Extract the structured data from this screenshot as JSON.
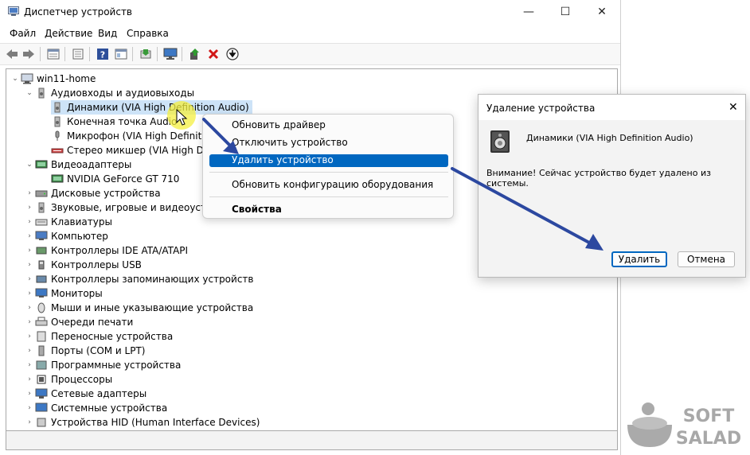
{
  "window": {
    "title": "Диспетчер устройств",
    "controls": {
      "minimize": "—",
      "maximize": "☐",
      "close": "✕"
    }
  },
  "menu": [
    "Файл",
    "Действие",
    "Вид",
    "Справка"
  ],
  "toolbar_icons": [
    "back-icon",
    "forward-icon",
    "properties-icon",
    "device-list-icon",
    "help-icon",
    "details-icon",
    "update-driver-icon",
    "monitor-icon",
    "add-device-icon",
    "remove-icon",
    "download-icon"
  ],
  "tree": {
    "root": "win11-home",
    "audio_group": "Аудиовходы и аудиовыходы",
    "audio_children": [
      "Динамики (VIA High Definition Audio)",
      "Конечная точка Audio",
      "Микрофон (VIA High Definiti",
      "Стерео микшер (VIA High Defi"
    ],
    "video_group": "Видеоадаптеры",
    "video_children": [
      "NVIDIA GeForce GT 710"
    ],
    "groups": [
      "Дисковые устройства",
      "Звуковые, игровые и видеоустро",
      "Клавиатуры",
      "Компьютер",
      "Контроллеры IDE ATA/ATAPI",
      "Контроллеры USB",
      "Контроллеры запоминающих устройств",
      "Мониторы",
      "Мыши и иные указывающие устройства",
      "Очереди печати",
      "Переносные устройства",
      "Порты (COM и LPT)",
      "Программные устройства",
      "Процессоры",
      "Сетевые адаптеры",
      "Системные устройства",
      "Устройства HID (Human Interface Devices)"
    ]
  },
  "context_menu": {
    "update_driver": "Обновить драйвер",
    "disable": "Отключить устройство",
    "uninstall": "Удалить устройство",
    "scan": "Обновить конфигурацию оборудования",
    "properties": "Свойства"
  },
  "dialog": {
    "title": "Удаление устройства",
    "device_name": "Динамики (VIA High Definition Audio)",
    "warning": "Внимание! Сейчас устройство будет удалено из системы.",
    "ok_label": "Удалить",
    "cancel_label": "Отмена",
    "close": "✕"
  },
  "watermark": {
    "line1": "SOFT",
    "line2": "SALAD"
  },
  "colors": {
    "accent": "#0067c0",
    "arrow": "#2c48a0",
    "selection": "#cde3f7"
  }
}
